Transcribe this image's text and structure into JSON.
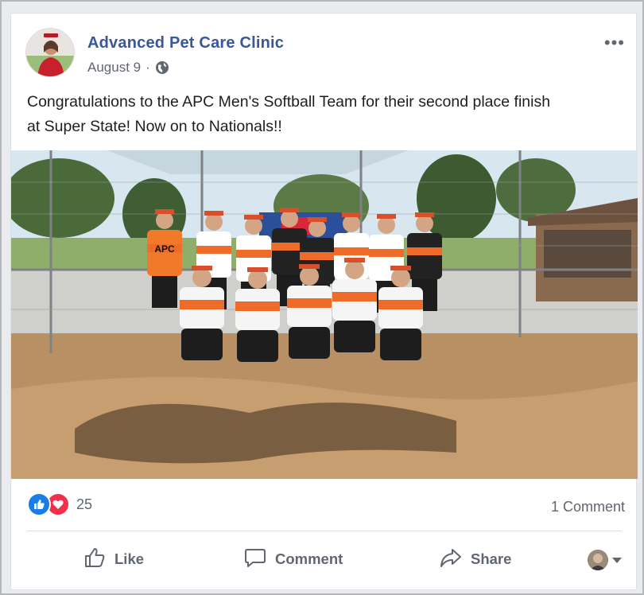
{
  "post": {
    "page_name": "Advanced Pet Care Clinic",
    "date": "August 9",
    "separator": "·",
    "audience_icon": "globe-icon",
    "more_icon": "more-options-icon",
    "more_label": "•••",
    "caption_line1": "Congratulations to the APC Men's Softball Team for their second place finish",
    "caption_line2": "at Super State! Now on to Nationals!!",
    "photo_description_icon": "team-photo",
    "team_jersey_text": "APC"
  },
  "stats": {
    "reaction_icons": [
      "like-icon",
      "love-icon"
    ],
    "reaction_count": "25",
    "comments_label": "1 Comment"
  },
  "actions": {
    "like_label": "Like",
    "comment_label": "Comment",
    "share_label": "Share"
  },
  "colors": {
    "brand_blue": "#385898",
    "like_blue": "#1a7ce6",
    "love_red": "#f0304a",
    "text": "#1c1e21",
    "muted": "#606770"
  }
}
